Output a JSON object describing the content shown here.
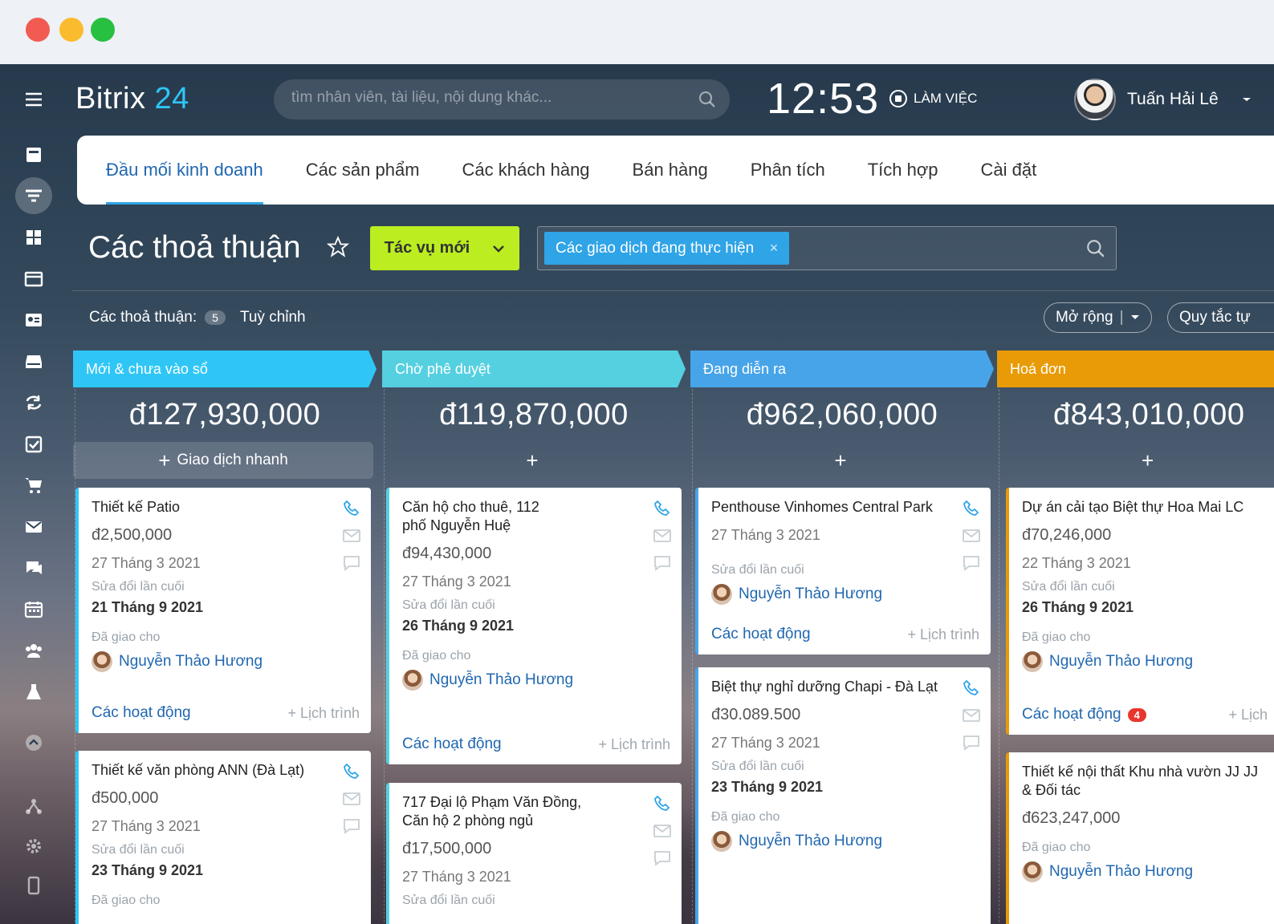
{
  "window": {
    "controls": [
      "close",
      "minimize",
      "maximize"
    ]
  },
  "brand": {
    "name": "Bitrix",
    "number": "24"
  },
  "search": {
    "placeholder": "tìm nhân viên, tài liệu, nội dung khác..."
  },
  "clock": "12:53",
  "work_status": "LÀM VIỆC",
  "user": {
    "name": "Tuấn Hải Lê"
  },
  "sidebar": {
    "icons": [
      "menu-icon",
      "news-icon",
      "crm-icon",
      "apps-icon",
      "calendar-window-icon",
      "contact-card-icon",
      "drive-icon",
      "sync-icon",
      "tasks-icon",
      "shop-icon",
      "mail-icon",
      "chat-icon",
      "schedule-icon",
      "groups-icon",
      "lab-icon",
      "up-icon",
      "sites-icon",
      "settings-icon",
      "mobile-icon"
    ]
  },
  "tabs": [
    "Đầu mối kinh doanh",
    "Các sản phẩm",
    "Các khách hàng",
    "Bán hàng",
    "Phân tích",
    "Tích hợp",
    "Cài đặt"
  ],
  "page": {
    "title": "Các thoả thuận",
    "new_button": "Tác vụ mới",
    "filter_chip": "Các giao dịch đang thực hiện",
    "counter_label": "Các thoả thuận:",
    "counter_value": "5",
    "customize": "Tuỳ chỉnh",
    "expand_button": "Mở rộng",
    "rules_button": "Quy tắc tự"
  },
  "columns": [
    {
      "name": "Mới & chưa vào sổ",
      "sum": "đ127,930,000",
      "color": "#2fc6f6",
      "quick": "Giao dịch nhanh"
    },
    {
      "name": "Chờ phê duyệt",
      "sum": "đ119,870,000",
      "color": "#55d0e0",
      "quick": "+"
    },
    {
      "name": "Đang diễn ra",
      "sum": "đ962,060,000",
      "color": "#47a4e8",
      "quick": "+"
    },
    {
      "name": "Hoá đơn",
      "sum": "đ843,010,000",
      "color": "#e89b06",
      "quick": "+"
    }
  ],
  "labels": {
    "last_modified": "Sửa đổi lần cuối",
    "assigned": "Đã giao cho",
    "activities": "Các hoạt động",
    "schedule": "+ Lịch trình",
    "schedule_cut": "+ Lịch"
  },
  "cards": {
    "c1a": {
      "name": "Thiết kế Patio",
      "amount": "đ2,500,000",
      "date": "27 Tháng 3 2021",
      "modified": "21 Tháng 9 2021",
      "assignee": "Nguyễn Thảo Hương"
    },
    "c1b": {
      "name": "Thiết kế văn phòng ANN (Đà Lạt)",
      "amount": "đ500,000",
      "date": "27 Tháng 3 2021",
      "modified": "23 Tháng 9 2021"
    },
    "c2a": {
      "name": "Căn hộ cho thuê, 112 phố Nguyễn Huệ",
      "amount": "đ94,430,000",
      "date": "27 Tháng 3 2021",
      "modified": "26 Tháng 9 2021",
      "assignee": "Nguyễn Thảo Hương"
    },
    "c2b": {
      "name": "717 Đại lộ Phạm Văn Đồng, Căn hộ 2 phòng ngủ",
      "amount": "đ17,500,000",
      "date": "27 Tháng 3 2021"
    },
    "c3a": {
      "name": "Penthouse Vinhomes Central Park",
      "date": "27 Tháng 3 2021",
      "assignee": "Nguyễn Thảo Hương"
    },
    "c3b": {
      "name": "Biệt thự nghỉ dưỡng Chapi - Đà Lạt",
      "amount": "đ30.089.500",
      "date": "27 Tháng 3 2021",
      "modified": "23 Tháng 9 2021",
      "assignee": "Nguyễn Thảo Hương"
    },
    "c4a": {
      "name": "Dự án cải tạo Biệt thự Hoa Mai LC",
      "amount": "đ70,246,000",
      "date": "22 Tháng 3 2021",
      "modified": "26 Tháng 9 2021",
      "assignee": "Nguyễn Thảo Hương",
      "activity_count": "4"
    },
    "c4b": {
      "name": "Thiết kế nội thất Khu nhà vườn JJ JJ & Đối tác",
      "amount": "đ623,247,000",
      "assignee": "Nguyễn Thảo Hương"
    }
  }
}
